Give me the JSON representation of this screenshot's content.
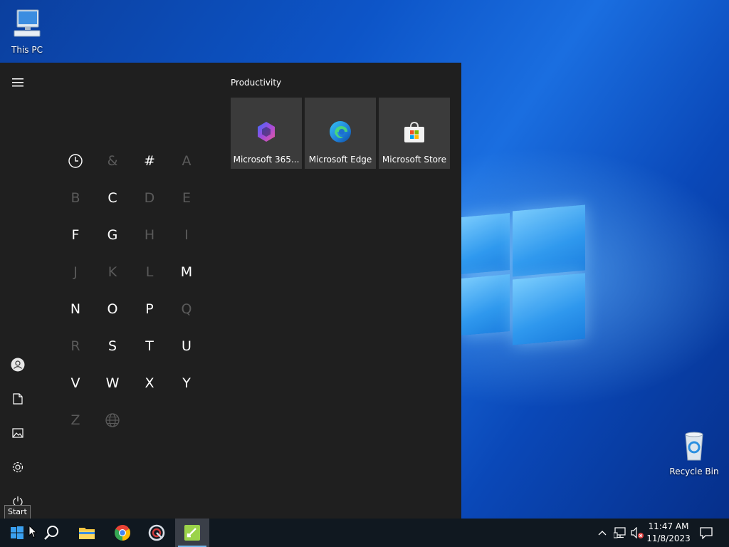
{
  "desktop": {
    "icons": [
      {
        "label": "This PC"
      },
      {
        "label": "Recycle Bin"
      }
    ]
  },
  "start_menu": {
    "group_title": "Productivity",
    "tiles": [
      {
        "label": "Microsoft 365...",
        "icon": "microsoft-365-icon"
      },
      {
        "label": "Microsoft Edge",
        "icon": "edge-icon"
      },
      {
        "label": "Microsoft Store",
        "icon": "store-icon"
      }
    ],
    "rail": [
      "hamburger-icon",
      "user-icon",
      "documents-icon",
      "pictures-icon",
      "settings-icon",
      "power-icon"
    ],
    "letters": [
      {
        "t": "&",
        "on": false
      },
      {
        "t": "#",
        "on": true
      },
      {
        "t": "A",
        "on": false
      },
      {
        "t": "B",
        "on": false
      },
      {
        "t": "C",
        "on": true
      },
      {
        "t": "D",
        "on": false
      },
      {
        "t": "E",
        "on": false
      },
      {
        "t": "F",
        "on": true
      },
      {
        "t": "G",
        "on": true
      },
      {
        "t": "H",
        "on": false
      },
      {
        "t": "I",
        "on": false
      },
      {
        "t": "J",
        "on": false
      },
      {
        "t": "K",
        "on": false
      },
      {
        "t": "L",
        "on": false
      },
      {
        "t": "M",
        "on": true
      },
      {
        "t": "N",
        "on": true
      },
      {
        "t": "O",
        "on": true
      },
      {
        "t": "P",
        "on": true
      },
      {
        "t": "Q",
        "on": false
      },
      {
        "t": "R",
        "on": false
      },
      {
        "t": "S",
        "on": true
      },
      {
        "t": "T",
        "on": true
      },
      {
        "t": "U",
        "on": true
      },
      {
        "t": "V",
        "on": true
      },
      {
        "t": "W",
        "on": true
      },
      {
        "t": "X",
        "on": true
      },
      {
        "t": "Y",
        "on": true
      },
      {
        "t": "Z",
        "on": false
      }
    ]
  },
  "tooltip": "Start",
  "taskbar": {
    "apps": [
      "start-icon",
      "search-icon",
      "file-explorer-icon",
      "chrome-icon",
      "app-icon",
      "active-app-icon"
    ],
    "time": "11:47 AM",
    "date": "11/8/2023"
  },
  "colors": {
    "accent": "#76b9ed",
    "start_bg": "#1f1f1f",
    "tile_bg": "#3b3b3b",
    "taskbar_bg": "#101820"
  }
}
